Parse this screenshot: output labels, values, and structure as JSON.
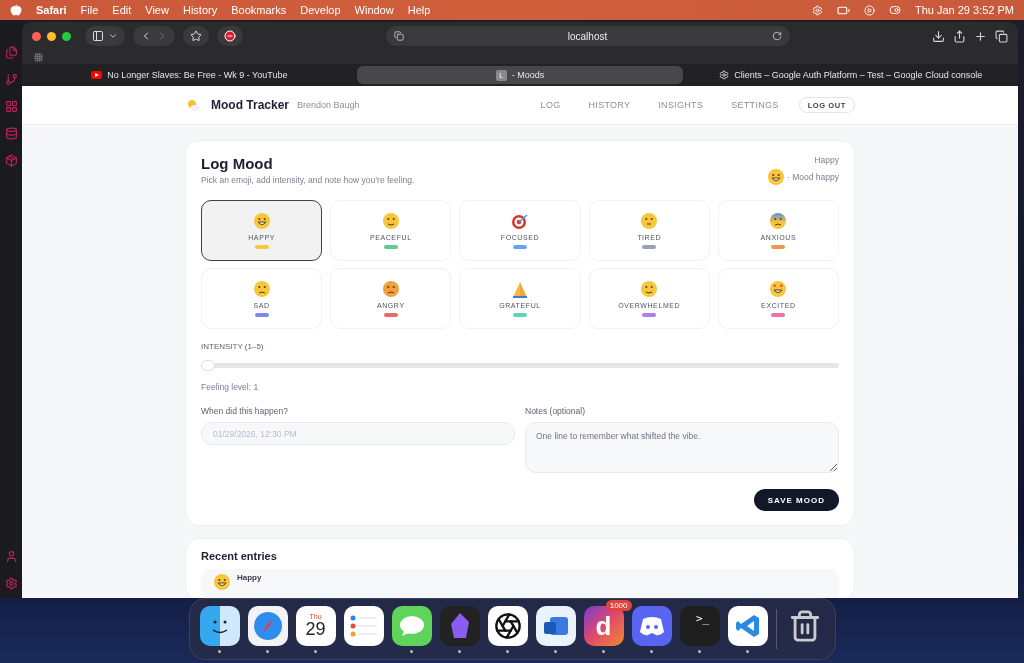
{
  "menu_bar": {
    "app": "Safari",
    "items": [
      "File",
      "Edit",
      "View",
      "History",
      "Bookmarks",
      "Develop",
      "Window",
      "Help"
    ],
    "clock": "Thu Jan 29  3:52 PM"
  },
  "browser": {
    "address": "localhost",
    "tabs": [
      {
        "kind": "video",
        "title": "No Longer Slaves: Be Free - Wk 9 - YouTube",
        "selected": false
      },
      {
        "kind": "letter",
        "badge": "L",
        "title": "- Moods",
        "selected": true
      },
      {
        "kind": "cloud",
        "title": "Clients – Google Auth Platform – Test – Google Cloud console",
        "selected": false
      }
    ]
  },
  "header": {
    "brand": "Mood Tracker",
    "user": "Brendon Baugh",
    "nav": [
      "LOG",
      "HISTORY",
      "INSIGHTS",
      "SETTINGS"
    ],
    "logout": "LOG OUT"
  },
  "log_mood": {
    "title": "Log Mood",
    "subtitle": "Pick an emoji, add intensity, and note how you’re feeling.",
    "current": {
      "name": "Happy",
      "caption": "· Mood happy"
    },
    "moods": [
      {
        "label": "HAPPY",
        "color": "#f5c842",
        "selected": true
      },
      {
        "label": "PEACEFUL",
        "color": "#5ccf8e",
        "selected": false
      },
      {
        "label": "FOCUSED",
        "color": "#67a3f5",
        "selected": false
      },
      {
        "label": "TIRED",
        "color": "#98a1b3",
        "selected": false
      },
      {
        "label": "ANXIOUS",
        "color": "#f2964a",
        "selected": false
      },
      {
        "label": "SAD",
        "color": "#7f86f0",
        "selected": false
      },
      {
        "label": "ANGRY",
        "color": "#ea6a6a",
        "selected": false
      },
      {
        "label": "GRATEFUL",
        "color": "#5dd3bd",
        "selected": false
      },
      {
        "label": "OVERWHELMED",
        "color": "#b07cf0",
        "selected": false
      },
      {
        "label": "EXCITED",
        "color": "#ee6fb3",
        "selected": false
      }
    ],
    "intensity": {
      "label": "INTENSITY (1–5)",
      "level": 0,
      "reading": "Feeling level: 1"
    },
    "when": {
      "label": "When did this happen?",
      "value": "01/29/2026, 12:30 PM"
    },
    "notes": {
      "label": "Notes (optional)",
      "placeholder": "One line to remember what shifted the vibe."
    },
    "save": "SAVE MOOD"
  },
  "recent": {
    "title": "Recent entries",
    "entries": [
      {
        "name": "Happy"
      }
    ]
  },
  "dock": {
    "items": [
      {
        "kind": "finder",
        "running": true
      },
      {
        "kind": "safari",
        "running": true
      },
      {
        "kind": "calendar",
        "day": "Thu",
        "date": "29",
        "running": true
      },
      {
        "kind": "reminders",
        "running": false
      },
      {
        "kind": "messages",
        "running": true
      },
      {
        "kind": "obsidian",
        "running": true
      },
      {
        "kind": "chatgpt",
        "running": true
      },
      {
        "kind": "outlook",
        "running": true
      },
      {
        "kind": "letter",
        "glyph": "d",
        "badge": "1000",
        "running": true
      },
      {
        "kind": "discord",
        "running": true
      },
      {
        "kind": "terminal",
        "prompt": ">_",
        "running": true
      },
      {
        "kind": "vscode",
        "running": true
      },
      {
        "kind": "trash",
        "running": false
      }
    ]
  }
}
